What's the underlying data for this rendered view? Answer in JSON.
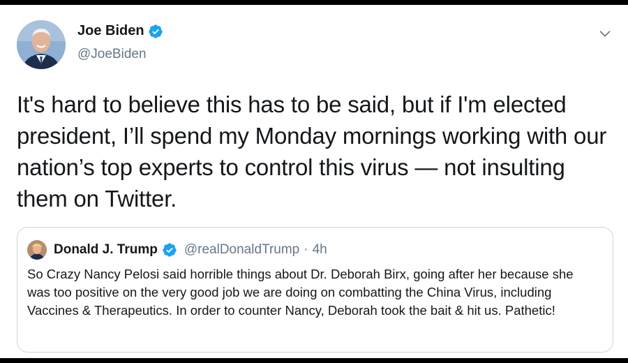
{
  "tweet": {
    "author": {
      "display_name": "Joe Biden",
      "handle": "@JoeBiden",
      "verified": true
    },
    "text": "It's hard to believe this has to be said, but if I'm elected president, I’ll spend my Monday mornings working with our nation’s top experts to control this virus — not insulting them on Twitter.",
    "menu_icon": "chevron-down-icon"
  },
  "quoted_tweet": {
    "author": {
      "display_name": "Donald J. Trump",
      "handle": "@realDonaldTrump",
      "verified": true
    },
    "separator": "·",
    "time": "4h",
    "text": "So Crazy Nancy Pelosi said horrible things about Dr. Deborah Birx, going after her because she was too positive on the very good job we are doing on combatting the China Virus, including Vaccines & Therapeutics. In order to counter Nancy, Deborah took the bait & hit us. Pathetic!"
  },
  "colors": {
    "verified_blue": "#1da1f2",
    "secondary_text": "#657786",
    "border": "#ccd6dd"
  }
}
